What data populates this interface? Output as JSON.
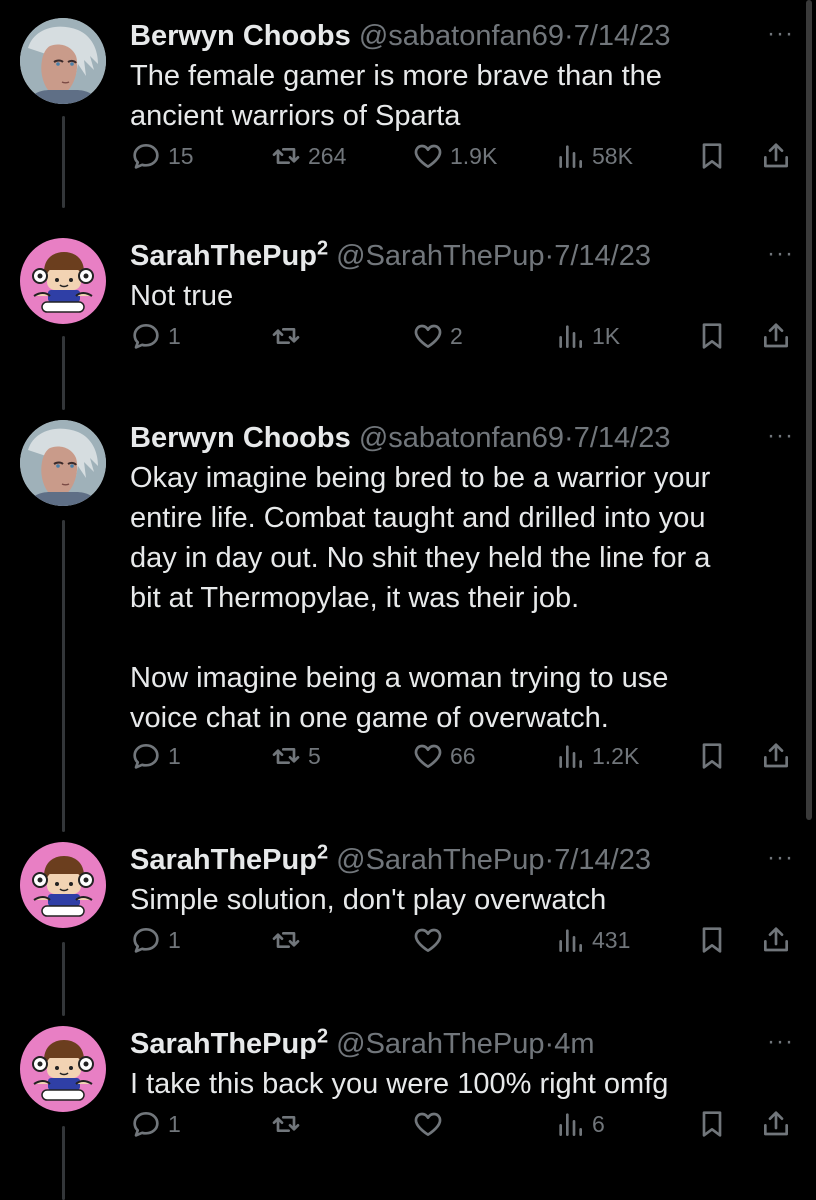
{
  "tweets": [
    {
      "name": "Berwyn Choobs",
      "name_sup": "",
      "handle": "@sabatonfan69",
      "dot": "·",
      "time": "7/14/23",
      "more": "···",
      "text": "The female gamer is more brave than the\nancient warriors of Sparta",
      "avatar": "berwyn-avatar",
      "replies": "15",
      "retweets": "264",
      "likes": "1.9K",
      "views": "58K"
    },
    {
      "name": "SarahThePup",
      "name_sup": "2",
      "handle": "@SarahThePup",
      "dot": "·",
      "time": "7/14/23",
      "more": "···",
      "text": "Not true",
      "avatar": "sarah-avatar",
      "replies": "1",
      "retweets": "",
      "likes": "2",
      "views": "1K"
    },
    {
      "name": "Berwyn Choobs",
      "name_sup": "",
      "handle": "@sabatonfan69",
      "dot": "·",
      "time": "7/14/23",
      "more": "···",
      "text": "Okay imagine being bred to be a warrior your\nentire life. Combat taught and drilled into you\nday in day out. No shit they held the line for a\nbit at Thermopylae, it was their job.\n\nNow imagine being a woman trying to use\nvoice chat in one game of overwatch.",
      "avatar": "berwyn-avatar",
      "replies": "1",
      "retweets": "5",
      "likes": "66",
      "views": "1.2K"
    },
    {
      "name": "SarahThePup",
      "name_sup": "2",
      "handle": "@SarahThePup",
      "dot": "·",
      "time": "7/14/23",
      "more": "···",
      "text": "Simple solution, don't play overwatch",
      "avatar": "sarah-avatar",
      "replies": "1",
      "retweets": "",
      "likes": "",
      "views": "431"
    },
    {
      "name": "SarahThePup",
      "name_sup": "2",
      "handle": "@SarahThePup",
      "dot": "·",
      "time": "4m",
      "more": "···",
      "text": "I take this back you were 100% right omfg",
      "avatar": "sarah-avatar",
      "replies": "1",
      "retweets": "",
      "likes": "",
      "views": "6"
    }
  ],
  "colors": {
    "background": "#000000",
    "text": "#e7e9ea",
    "muted": "#71767b",
    "thread_line": "#333639",
    "sarah_avatar_bg": "#e87fc4"
  }
}
